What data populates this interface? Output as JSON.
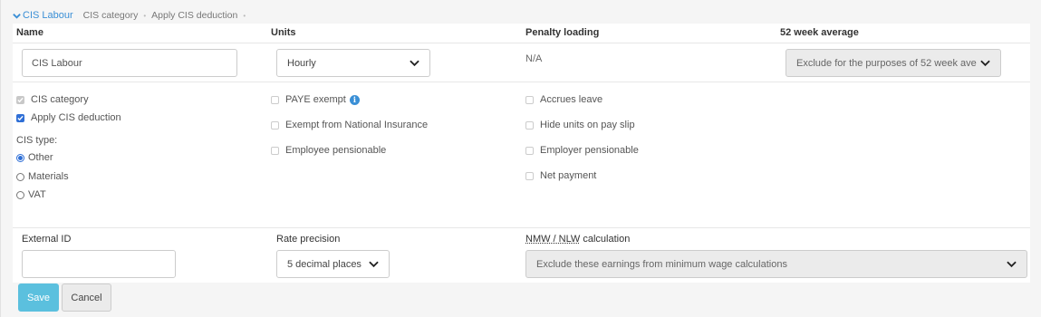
{
  "breadcrumb": {
    "current": "CIS Labour",
    "items": [
      "CIS category",
      "Apply CIS deduction"
    ],
    "separator": "•"
  },
  "headers": {
    "name": "Name",
    "units": "Units",
    "penalty_loading": "Penalty loading",
    "week_average": "52 week average"
  },
  "fields": {
    "name_value": "CIS Labour",
    "units_value": "Hourly",
    "penalty_loading_value": "N/A",
    "week_average_value": "Exclude for the purposes of 52 week ave"
  },
  "checkboxes": {
    "cis_category": {
      "label": "CIS category",
      "checked": true,
      "disabled": true
    },
    "apply_cis_deduction": {
      "label": "Apply CIS deduction",
      "checked": true
    },
    "paye_exempt": {
      "label": "PAYE exempt",
      "checked": false
    },
    "exempt_ni": {
      "label": "Exempt from National Insurance",
      "checked": false
    },
    "employee_pensionable": {
      "label": "Employee pensionable",
      "checked": false
    },
    "accrues_leave": {
      "label": "Accrues leave",
      "checked": false
    },
    "hide_units": {
      "label": "Hide units on pay slip",
      "checked": false
    },
    "employer_pensionable": {
      "label": "Employer pensionable",
      "checked": false
    },
    "net_payment": {
      "label": "Net payment",
      "checked": false
    }
  },
  "cis_type": {
    "label": "CIS type:",
    "options": [
      "Other",
      "Materials",
      "VAT"
    ],
    "selected": "Other"
  },
  "bottom": {
    "external_id_label": "External ID",
    "external_id_value": "",
    "rate_precision_label": "Rate precision",
    "rate_precision_value": "5 decimal places",
    "nmw_abbr": "NMW / NLW",
    "nmw_suffix": " calculation",
    "nmw_value": "Exclude these earnings from minimum wage calculations"
  },
  "buttons": {
    "save": "Save",
    "cancel": "Cancel"
  },
  "colors": {
    "accent": "#3a8fd6",
    "save_button": "#5bc0de",
    "checkbox_checked": "#2f6fd6"
  },
  "icons": {
    "breadcrumb_toggle": "chevron-down-icon",
    "paye_info": "info-icon",
    "select_caret": "chevron-down-icon"
  }
}
